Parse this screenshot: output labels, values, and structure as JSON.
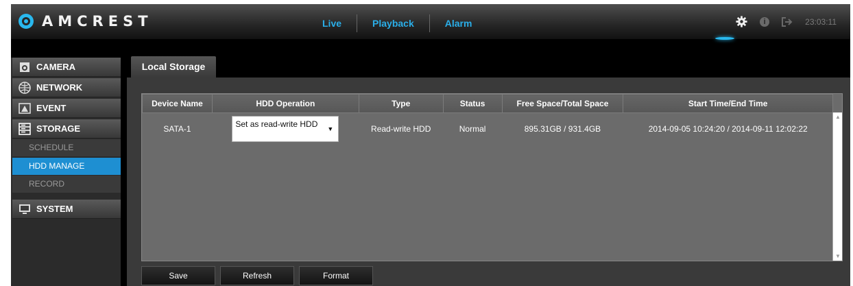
{
  "brand": {
    "name": "AMCREST"
  },
  "nav": [
    {
      "label": "Live"
    },
    {
      "label": "Playback"
    },
    {
      "label": "Alarm"
    }
  ],
  "toolbar": {
    "gear_icon": "gear-icon",
    "info_glyph": "i",
    "logout_icon": "logout-icon",
    "clock": "23:03:11"
  },
  "sidebar": {
    "camera": "CAMERA",
    "network": "NETWORK",
    "event": "EVENT",
    "storage": "STORAGE",
    "submenu": [
      {
        "label": "SCHEDULE"
      },
      {
        "label": "HDD MANAGE"
      },
      {
        "label": "RECORD"
      }
    ],
    "system": "SYSTEM"
  },
  "tab": {
    "label": "Local Storage"
  },
  "table": {
    "headers": [
      "Device Name",
      "HDD Operation",
      "Type",
      "Status",
      "Free Space/Total Space",
      "Start Time/End Time"
    ],
    "rows": [
      {
        "device": "SATA-1",
        "operation": "Set as read-write HDD",
        "type": "Read-write HDD",
        "status": "Normal",
        "space": "895.31GB / 931.4GB",
        "time": "2014-09-05 10:24:20 / 2014-09-11 12:02:22"
      }
    ]
  },
  "buttons": {
    "save": "Save",
    "refresh": "Refresh",
    "format": "Format"
  },
  "colors": {
    "accent": "#1e8fd2",
    "nav_text": "#2aaee8",
    "header_bg": "#2e2e2e",
    "content_bg": "#3a3a3a"
  }
}
